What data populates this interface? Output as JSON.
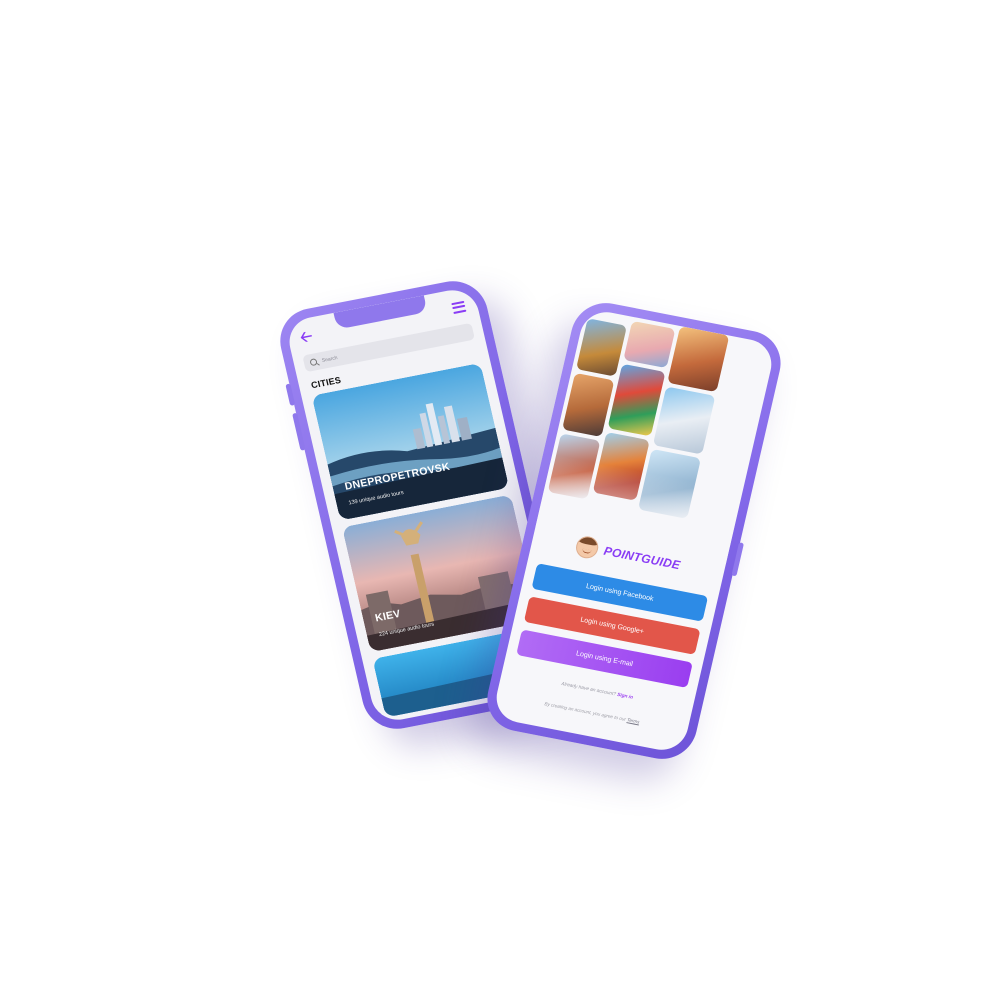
{
  "cities_screen": {
    "search_placeholder": "Search",
    "section_title": "CITIES",
    "cities": [
      {
        "name": "DNEPROPETROVSK",
        "subtitle": "139 unique audio tours"
      },
      {
        "name": "KIEV",
        "subtitle": "224 unique audio tours"
      }
    ]
  },
  "login_screen": {
    "brand_name": "POINTGUIDE",
    "buttons": {
      "facebook": "Login using Facebook",
      "google": "Login using Google+",
      "email": "Login using E-mail"
    },
    "account_prompt": "Already have an account?",
    "sign_in": "Sign in",
    "terms_prompt": "By creating an account, you agree to our",
    "terms_link": "Terms"
  },
  "colors": {
    "phone_body": "#8a70ee",
    "accent": "#8a3df5",
    "facebook": "#2d8be6",
    "google": "#e2564a",
    "email": "#a554f2"
  },
  "icons": [
    "back-arrow-icon",
    "menu-icon",
    "search-icon",
    "avatar-icon"
  ]
}
